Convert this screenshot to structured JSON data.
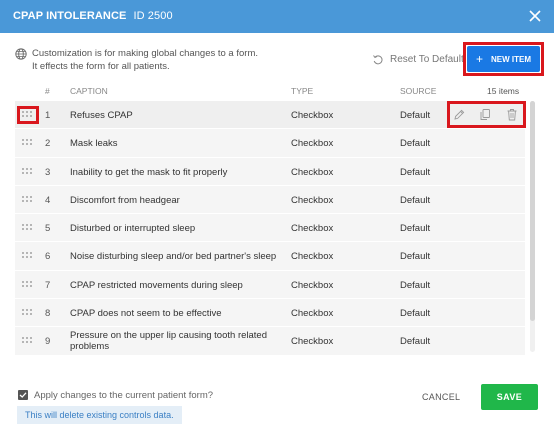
{
  "header": {
    "title": "CPAP INTOLERANCE",
    "id_label": "ID 2500"
  },
  "info": {
    "line1": "Customization is for making global changes to a form.",
    "line2": "It effects the form for all patients."
  },
  "toolbar": {
    "reset_label": "Reset To Default",
    "new_item_label": "NEW ITEM",
    "item_count": "15 items"
  },
  "table": {
    "headers": {
      "num": "#",
      "caption": "CAPTION",
      "type": "TYPE",
      "source": "SOURCE"
    },
    "rows": [
      {
        "num": "1",
        "caption": "Refuses CPAP",
        "type": "Checkbox",
        "source": "Default"
      },
      {
        "num": "2",
        "caption": "Mask leaks",
        "type": "Checkbox",
        "source": "Default"
      },
      {
        "num": "3",
        "caption": "Inability to get the mask to fit properly",
        "type": "Checkbox",
        "source": "Default"
      },
      {
        "num": "4",
        "caption": "Discomfort from headgear",
        "type": "Checkbox",
        "source": "Default"
      },
      {
        "num": "5",
        "caption": "Disturbed or interrupted sleep",
        "type": "Checkbox",
        "source": "Default"
      },
      {
        "num": "6",
        "caption": "Noise disturbing sleep and/or bed partner's sleep",
        "type": "Checkbox",
        "source": "Default"
      },
      {
        "num": "7",
        "caption": "CPAP restricted movements during sleep",
        "type": "Checkbox",
        "source": "Default"
      },
      {
        "num": "8",
        "caption": "CPAP does not seem to be effective",
        "type": "Checkbox",
        "source": "Default"
      },
      {
        "num": "9",
        "caption": "Pressure on the upper lip causing tooth related problems",
        "type": "Checkbox",
        "source": "Default"
      }
    ]
  },
  "footer": {
    "apply_label": "Apply changes to the current patient form?",
    "warning": "This will delete existing controls data.",
    "cancel_label": "CANCEL",
    "save_label": "SAVE"
  },
  "colors": {
    "header": "#4a98d8",
    "primary": "#1a79e4",
    "save": "#20b74a",
    "highlight": "#d9171d"
  },
  "icons": [
    "close-icon",
    "globe-icon",
    "reset-icon",
    "plus-icon",
    "drag-handle-icon",
    "edit-icon",
    "copy-icon",
    "delete-icon",
    "check-icon"
  ]
}
